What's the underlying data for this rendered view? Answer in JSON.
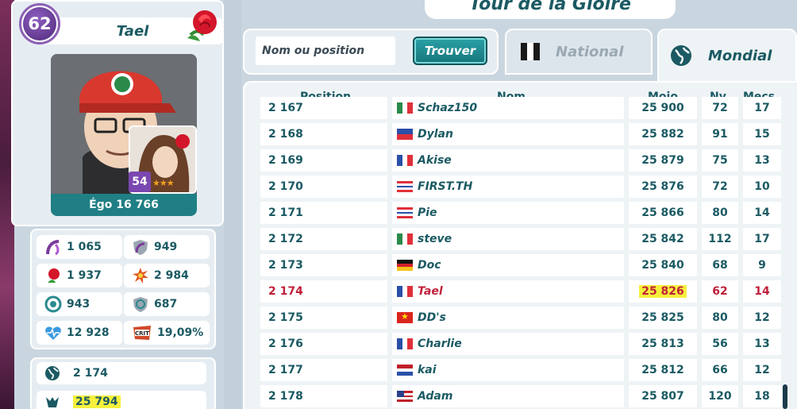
{
  "profile": {
    "level": "62",
    "name": "Tael",
    "ego_label": "Égo 16 766",
    "companion_level": "54",
    "companion_stars": "★★★"
  },
  "stats": [
    {
      "icon": "whip-icon",
      "value": "1 065"
    },
    {
      "icon": "whip-shield-icon",
      "value": "949"
    },
    {
      "icon": "rose-stat-icon",
      "value": "1 937"
    },
    {
      "icon": "burst-icon",
      "value": "2 984"
    },
    {
      "icon": "target-icon",
      "value": "943"
    },
    {
      "icon": "target-shield-icon",
      "value": "687"
    },
    {
      "icon": "heart-pulse-icon",
      "value": "12 928"
    },
    {
      "icon": "crit-icon",
      "value": "19,09%"
    }
  ],
  "summary": {
    "world_rank": "2 174",
    "mojo": "25 794"
  },
  "header": {
    "title": "Tour de la Gloire"
  },
  "search": {
    "placeholder": "Nom ou position",
    "button_label": "Trouver"
  },
  "tabs": {
    "national": "National",
    "mondial": "Mondial"
  },
  "table": {
    "headers": {
      "position": "Position",
      "name": "Nom",
      "mojo": "Mojo",
      "level": "Nv.",
      "mecs": "Mecs"
    },
    "rows": [
      {
        "position": "2 167",
        "flag": "mx",
        "name": "Schaz150",
        "mojo": "25 900",
        "level": "72",
        "mecs": "17",
        "me": false
      },
      {
        "position": "2 168",
        "flag": "ph",
        "name": "Dylan",
        "mojo": "25 882",
        "level": "91",
        "mecs": "15",
        "me": false
      },
      {
        "position": "2 169",
        "flag": "fr",
        "name": "Akise",
        "mojo": "25 879",
        "level": "75",
        "mecs": "13",
        "me": false
      },
      {
        "position": "2 170",
        "flag": "th",
        "name": "FIRST.TH",
        "mojo": "25 876",
        "level": "72",
        "mecs": "10",
        "me": false
      },
      {
        "position": "2 171",
        "flag": "th",
        "name": "Pie",
        "mojo": "25 866",
        "level": "80",
        "mecs": "14",
        "me": false
      },
      {
        "position": "2 172",
        "flag": "mx",
        "name": "steve",
        "mojo": "25 842",
        "level": "112",
        "mecs": "17",
        "me": false
      },
      {
        "position": "2 173",
        "flag": "de",
        "name": "Doc",
        "mojo": "25 840",
        "level": "68",
        "mecs": "9",
        "me": false
      },
      {
        "position": "2 174",
        "flag": "fr",
        "name": "Tael",
        "mojo": "25 826",
        "level": "62",
        "mecs": "14",
        "me": true
      },
      {
        "position": "2 175",
        "flag": "vn",
        "name": "DD's",
        "mojo": "25 825",
        "level": "80",
        "mecs": "12",
        "me": false
      },
      {
        "position": "2 176",
        "flag": "fr",
        "name": "Charlie",
        "mojo": "25 813",
        "level": "56",
        "mecs": "13",
        "me": false
      },
      {
        "position": "2 177",
        "flag": "nl",
        "name": "kai",
        "mojo": "25 812",
        "level": "66",
        "mecs": "12",
        "me": false
      },
      {
        "position": "2 178",
        "flag": "us",
        "name": "Adam",
        "mojo": "25 807",
        "level": "120",
        "mecs": "18",
        "me": false
      }
    ]
  },
  "colors": {
    "accent": "#1b5a63",
    "button": "#1f8a8f",
    "highlight": "#f6f03c",
    "self_row": "#c0203a"
  }
}
